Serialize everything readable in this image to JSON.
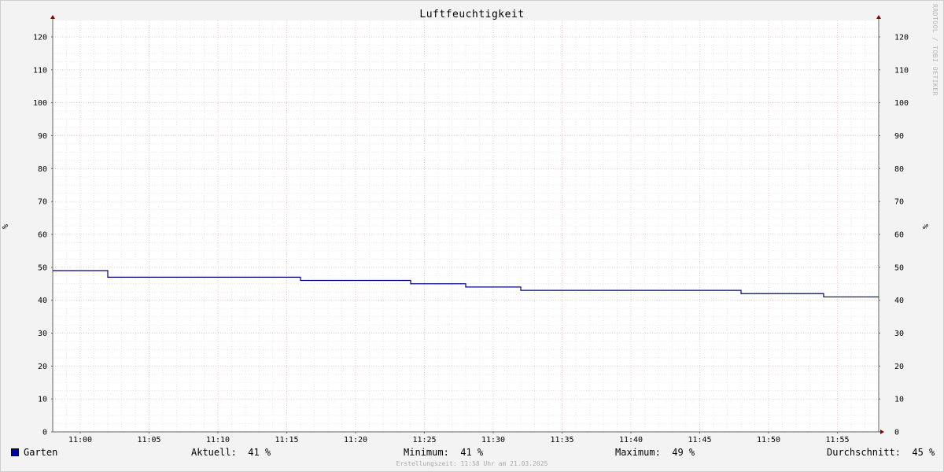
{
  "chart_data": {
    "type": "line",
    "title": "Luftfeuchtigkeit",
    "ylabel": "%",
    "ylabel_right": "%",
    "ylim": [
      0,
      125
    ],
    "y_ticks": [
      0,
      10,
      20,
      30,
      40,
      50,
      60,
      70,
      80,
      90,
      100,
      110,
      120
    ],
    "xlim": [
      "10:58",
      "11:58"
    ],
    "x_ticks": [
      "11:00",
      "11:05",
      "11:10",
      "11:15",
      "11:20",
      "11:25",
      "11:30",
      "11:35",
      "11:40",
      "11:45",
      "11:50",
      "11:55"
    ],
    "grid": true,
    "series": [
      {
        "name": "Garten",
        "color": "#000080",
        "step": true,
        "x": [
          "10:58",
          "11:02",
          "11:16",
          "11:24",
          "11:28",
          "11:32",
          "11:48",
          "11:54",
          "11:58"
        ],
        "values": [
          49,
          47,
          46,
          45,
          44,
          43,
          42,
          41,
          41
        ]
      }
    ]
  },
  "watermark": "RRDTOOL / TOBI OETIKER",
  "legend": {
    "series_label": "Garten",
    "swatch_color": "#0000aa",
    "aktuell": "Aktuell:  41 %",
    "minimum": "Minimum:  41 %",
    "maximum": "Maximum:  49 %",
    "durchschnitt": "Durchschnitt:  45 %"
  },
  "footer": "Erstellungszeit: 11:58 Uhr am 21.03.2025"
}
